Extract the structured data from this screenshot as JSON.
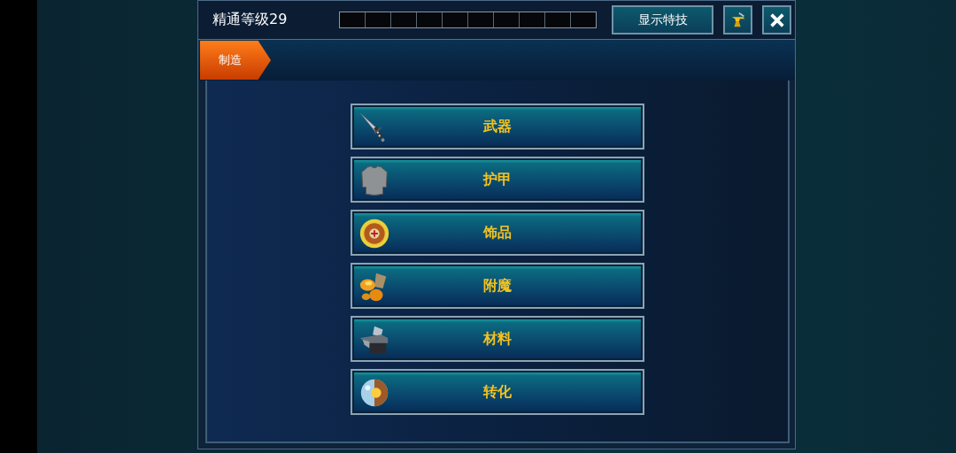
{
  "header": {
    "title": "精通等级29",
    "show_skills_button": "显示特技"
  },
  "tabs": [
    {
      "label": "制造",
      "selected": true
    }
  ],
  "categories": [
    {
      "label": "武器",
      "kind": "sword"
    },
    {
      "label": "护甲",
      "kind": "shirt"
    },
    {
      "label": "饰品",
      "kind": "medallion"
    },
    {
      "label": "附魔",
      "kind": "gold"
    },
    {
      "label": "材料",
      "kind": "anvil"
    },
    {
      "label": "转化",
      "kind": "orb"
    }
  ]
}
